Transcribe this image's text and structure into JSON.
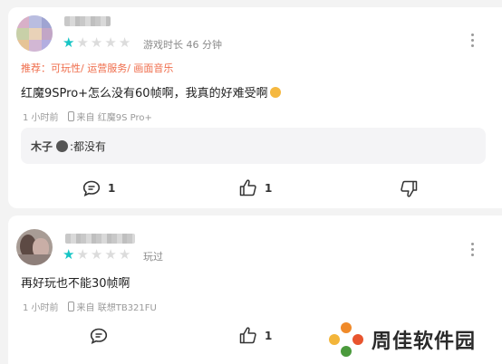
{
  "reviews": [
    {
      "username_hidden": true,
      "rating": 1,
      "max_rating": 5,
      "playtime": "游戏时长 46 分钟",
      "recommend": "推荐：可玩性/ 运营服务/ 画面音乐",
      "content": "红魔9SPro+怎么没有60帧啊，我真的好难受啊",
      "time": "1 小时前",
      "device": "来自 红魔9S Pro+",
      "reply": {
        "name": "木子",
        "text": ":都没有"
      },
      "comments": "1",
      "likes": "1"
    },
    {
      "username_hidden": true,
      "rating": 1,
      "max_rating": 5,
      "playtime": "玩过",
      "content": "再好玩也不能30帧啊",
      "time": "1 小时前",
      "device": "来自 联想TB321FU",
      "comments": "",
      "likes": "1"
    }
  ],
  "watermark": {
    "text": "周佳软件园"
  },
  "colors": {
    "star_on": "#17c5c5",
    "star_off": "#dcdcdc",
    "recommend": "#ef6c4a"
  }
}
